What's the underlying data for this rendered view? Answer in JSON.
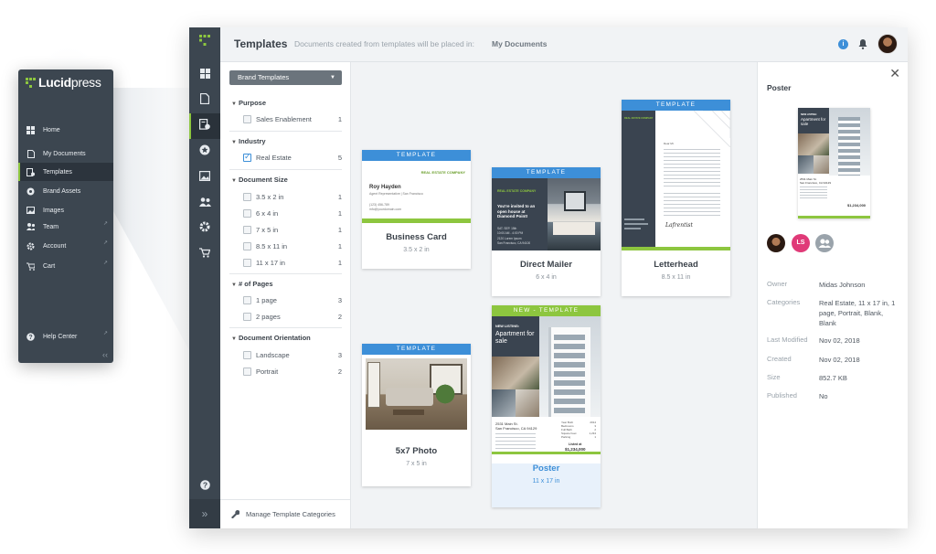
{
  "brand": {
    "name_bold": "Lucid",
    "name_light": "press",
    "accent": "#8dc63f"
  },
  "sidebar": {
    "items": [
      {
        "label": "Home",
        "icon": "grid-icon"
      },
      {
        "label": "My Documents",
        "icon": "document-icon"
      },
      {
        "label": "Templates",
        "icon": "templates-icon",
        "active": true
      },
      {
        "label": "Brand Assets",
        "icon": "brand-assets-icon"
      },
      {
        "label": "Images",
        "icon": "image-icon"
      },
      {
        "label": "Team",
        "icon": "team-icon"
      },
      {
        "label": "Account",
        "icon": "gear-icon"
      },
      {
        "label": "Cart",
        "icon": "cart-icon"
      },
      {
        "label": "Help Center",
        "icon": "help-icon"
      }
    ],
    "collapse_glyph": "‹‹"
  },
  "header": {
    "title": "Templates",
    "note": "Documents created from templates will be placed in:",
    "location": "My Documents",
    "info_glyph": "i"
  },
  "filters": {
    "dropdown": "Brand Templates",
    "groups": [
      {
        "title": "Purpose",
        "options": [
          {
            "label": "Sales Enablement",
            "count": "1",
            "checked": false
          }
        ]
      },
      {
        "title": "Industry",
        "options": [
          {
            "label": "Real Estate",
            "count": "5",
            "checked": true
          }
        ]
      },
      {
        "title": "Document Size",
        "options": [
          {
            "label": "3.5 x 2 in",
            "count": "1"
          },
          {
            "label": "6 x 4 in",
            "count": "1"
          },
          {
            "label": "7 x 5 in",
            "count": "1"
          },
          {
            "label": "8.5 x 11 in",
            "count": "1"
          },
          {
            "label": "11 x 17 in",
            "count": "1"
          }
        ]
      },
      {
        "title": "# of Pages",
        "options": [
          {
            "label": "1 page",
            "count": "3"
          },
          {
            "label": "2 pages",
            "count": "2"
          }
        ]
      },
      {
        "title": "Document Orientation",
        "options": [
          {
            "label": "Landscape",
            "count": "3"
          },
          {
            "label": "Portrait",
            "count": "2"
          }
        ]
      }
    ],
    "manage": "Manage Template Categories"
  },
  "templates": [
    {
      "band": "TEMPLATE",
      "name": "Business Card",
      "size": "3.5 x 2 in",
      "content": {
        "company": "REAL ESTATE COMPANY",
        "person": "Roy Hayden",
        "role": "Agent Representative | San Francisco",
        "phone": "(123) 456-789",
        "email": "info@yourdomain.com"
      }
    },
    {
      "band": "TEMPLATE",
      "name": "Direct Mailer",
      "size": "6 x 4 in",
      "content": {
        "company": "REAL ESTATE COMPANY",
        "headline": "You're invited to an open house at Diamond Point!",
        "line1": "SAT. SEP. 15th",
        "line2": "10:00 AM - 4:00 PM",
        "line3": "2120 Lorem Ipsum",
        "line4": "San Francisco, CA 94100"
      }
    },
    {
      "band": "TEMPLATE",
      "name": "Letterhead",
      "size": "8.5 x 11 in",
      "content": {
        "company": "REAL ESTATE COMPANY",
        "salutation": "Dear Mr.",
        "signature": "Lafrentist"
      }
    },
    {
      "band": "TEMPLATE",
      "name": "5x7 Photo",
      "size": "7 x 5 in"
    },
    {
      "band": "NEW - TEMPLATE",
      "name": "Poster",
      "size": "11 x 17 in",
      "selected": true,
      "content": {
        "kicker": "NEW LISTING:",
        "title": "Apartment for sale",
        "address1": "2531 Main St.",
        "address2": "San Francisco, CA 94129",
        "table": [
          [
            "Year Built",
            "2014"
          ],
          [
            "Bedrooms",
            "3"
          ],
          [
            "Full Bath",
            "2"
          ],
          [
            "Square Feet",
            "1,234"
          ],
          [
            "Parking",
            "1"
          ]
        ],
        "price_label": "Listed at",
        "price": "$1,234,000"
      }
    }
  ],
  "details": {
    "title": "Poster",
    "close_glyph": "✕",
    "collaborators": [
      {
        "kind": "photo",
        "initials": ""
      },
      {
        "kind": "initials",
        "initials": "LS",
        "color": "#e03a78"
      },
      {
        "kind": "group",
        "initials": "",
        "color": "#9aa3ab"
      }
    ],
    "fields": [
      {
        "label": "Owner",
        "value": "Midas Johnson"
      },
      {
        "label": "Categories",
        "value": "Real Estate, 11 x 17 in, 1 page, Portrait, Blank, Blank"
      },
      {
        "label": "Last Modified",
        "value": "Nov 02, 2018"
      },
      {
        "label": "Created",
        "value": "Nov 02, 2018"
      },
      {
        "label": "Size",
        "value": "852.7 KB"
      },
      {
        "label": "Published",
        "value": "No"
      }
    ]
  },
  "colors": {
    "rail": "#3c4650",
    "accent_blue": "#3d8fd8",
    "accent_green": "#8dc63f",
    "gallery_bg": "#f1f3f5"
  }
}
